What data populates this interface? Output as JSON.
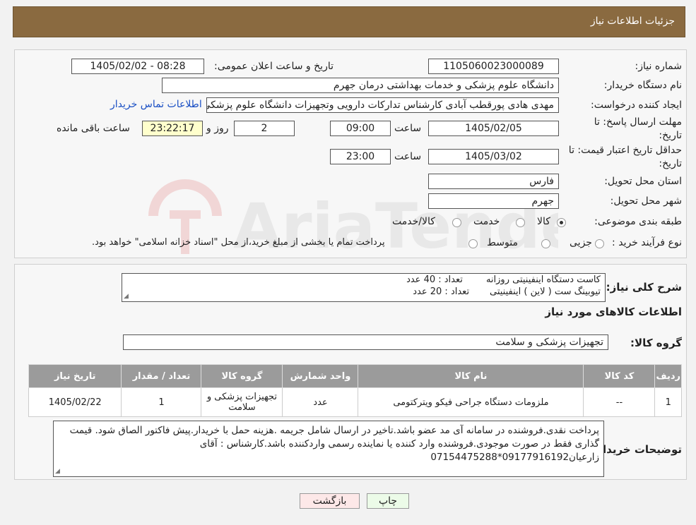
{
  "header": {
    "title": "جزئیات اطلاعات نیاز"
  },
  "form": {
    "need_number_label": "شماره نیاز:",
    "need_number": "1105060023000089",
    "announce_label": "تاریخ و ساعت اعلان عمومی:",
    "announce_value": "1405/02/02 - 08:28",
    "buyer_org_label": "نام دستگاه خریدار:",
    "buyer_org": "دانشگاه علوم پزشکی و خدمات بهداشتی  درمان جهرم",
    "creator_label": "ایجاد کننده درخواست:",
    "creator": "مهدی هادی پورقطب آبادی کارشناس تدارکات دارویی وتجهیزات دانشگاه علوم پزشکی",
    "contact_link": "اطلاعات تماس خریدار",
    "deadline_label_1": "مهلت ارسال پاسخ: تا",
    "deadline_label_2": "تاریخ:",
    "deadline_date": "1405/02/05",
    "time_word": "ساعت",
    "deadline_time": "09:00",
    "days_value": "2",
    "days_word": "روز و",
    "remaining_time": "23:22:17",
    "remaining_word": "ساعت باقی مانده",
    "validity_label_1": "حداقل تاریخ اعتبار قیمت: تا",
    "validity_label_2": "تاریخ:",
    "validity_date": "1405/03/02",
    "validity_time": "23:00",
    "province_label": "استان محل تحویل:",
    "province": "فارس",
    "city_label": "شهر محل تحویل:",
    "city": "جهرم",
    "category_label": "طبقه بندی موضوعی:",
    "category_options": [
      "کالا",
      "خدمت",
      "کالا/خدمت"
    ],
    "category_selected": "کالا",
    "process_label": "نوع فرآیند خرید :",
    "process_options": [
      "جزیی",
      "متوسط"
    ],
    "process_note": "پرداخت تمام یا بخشی از مبلغ خرید،از محل \"اسناد خزانه اسلامی\" خواهد بود."
  },
  "summary": {
    "label": "شرح کلی نیاز:",
    "line1": "کاست دستگاه اینفینیتی روزانه        تعداد : 40 عدد",
    "line2": "تیوبینگ ست ( لاین ) اینفینیتی       تعداد : 20 عدد",
    "goods_info_title": "اطلاعات کالاهای مورد نیاز",
    "group_label": "گروه کالا:",
    "group_value": "تجهیزات پزشکی و سلامت"
  },
  "table": {
    "headers": [
      "ردیف",
      "کد کالا",
      "نام کالا",
      "واحد شمارش",
      "گروه کالا",
      "تعداد / مقدار",
      "تاریخ نیاز"
    ],
    "rows": [
      [
        "1",
        "--",
        "ملزومات دستگاه جراحی فیکو ویترکتومی",
        "عدد",
        "تجهیزات پزشکی و سلامت",
        "1",
        "1405/02/22"
      ]
    ]
  },
  "buyer_notes": {
    "label": "توضیحات خریدار:",
    "text": "پرداخت نقدی.فروشنده در سامانه آی مد عضو باشد.تاخیر در ارسال شامل جریمه .هزینه حمل با خریدار.پیش فاکتور الصاق شود. قیمت گذاری فقط در صورت موجودی.فروشنده وارد کننده یا نماینده رسمی واردکننده باشد.کارشناس : آقای زارعیان09177916192*07154475288"
  },
  "buttons": {
    "print": "چاپ",
    "back": "بازگشت"
  },
  "watermark": {
    "text": "AriaTender.neT"
  },
  "colors": {
    "header_bg": "#8a6a40",
    "table_header_bg": "#9b9b9b",
    "link": "#1a4fc4",
    "highlight": "#ffffcc"
  }
}
